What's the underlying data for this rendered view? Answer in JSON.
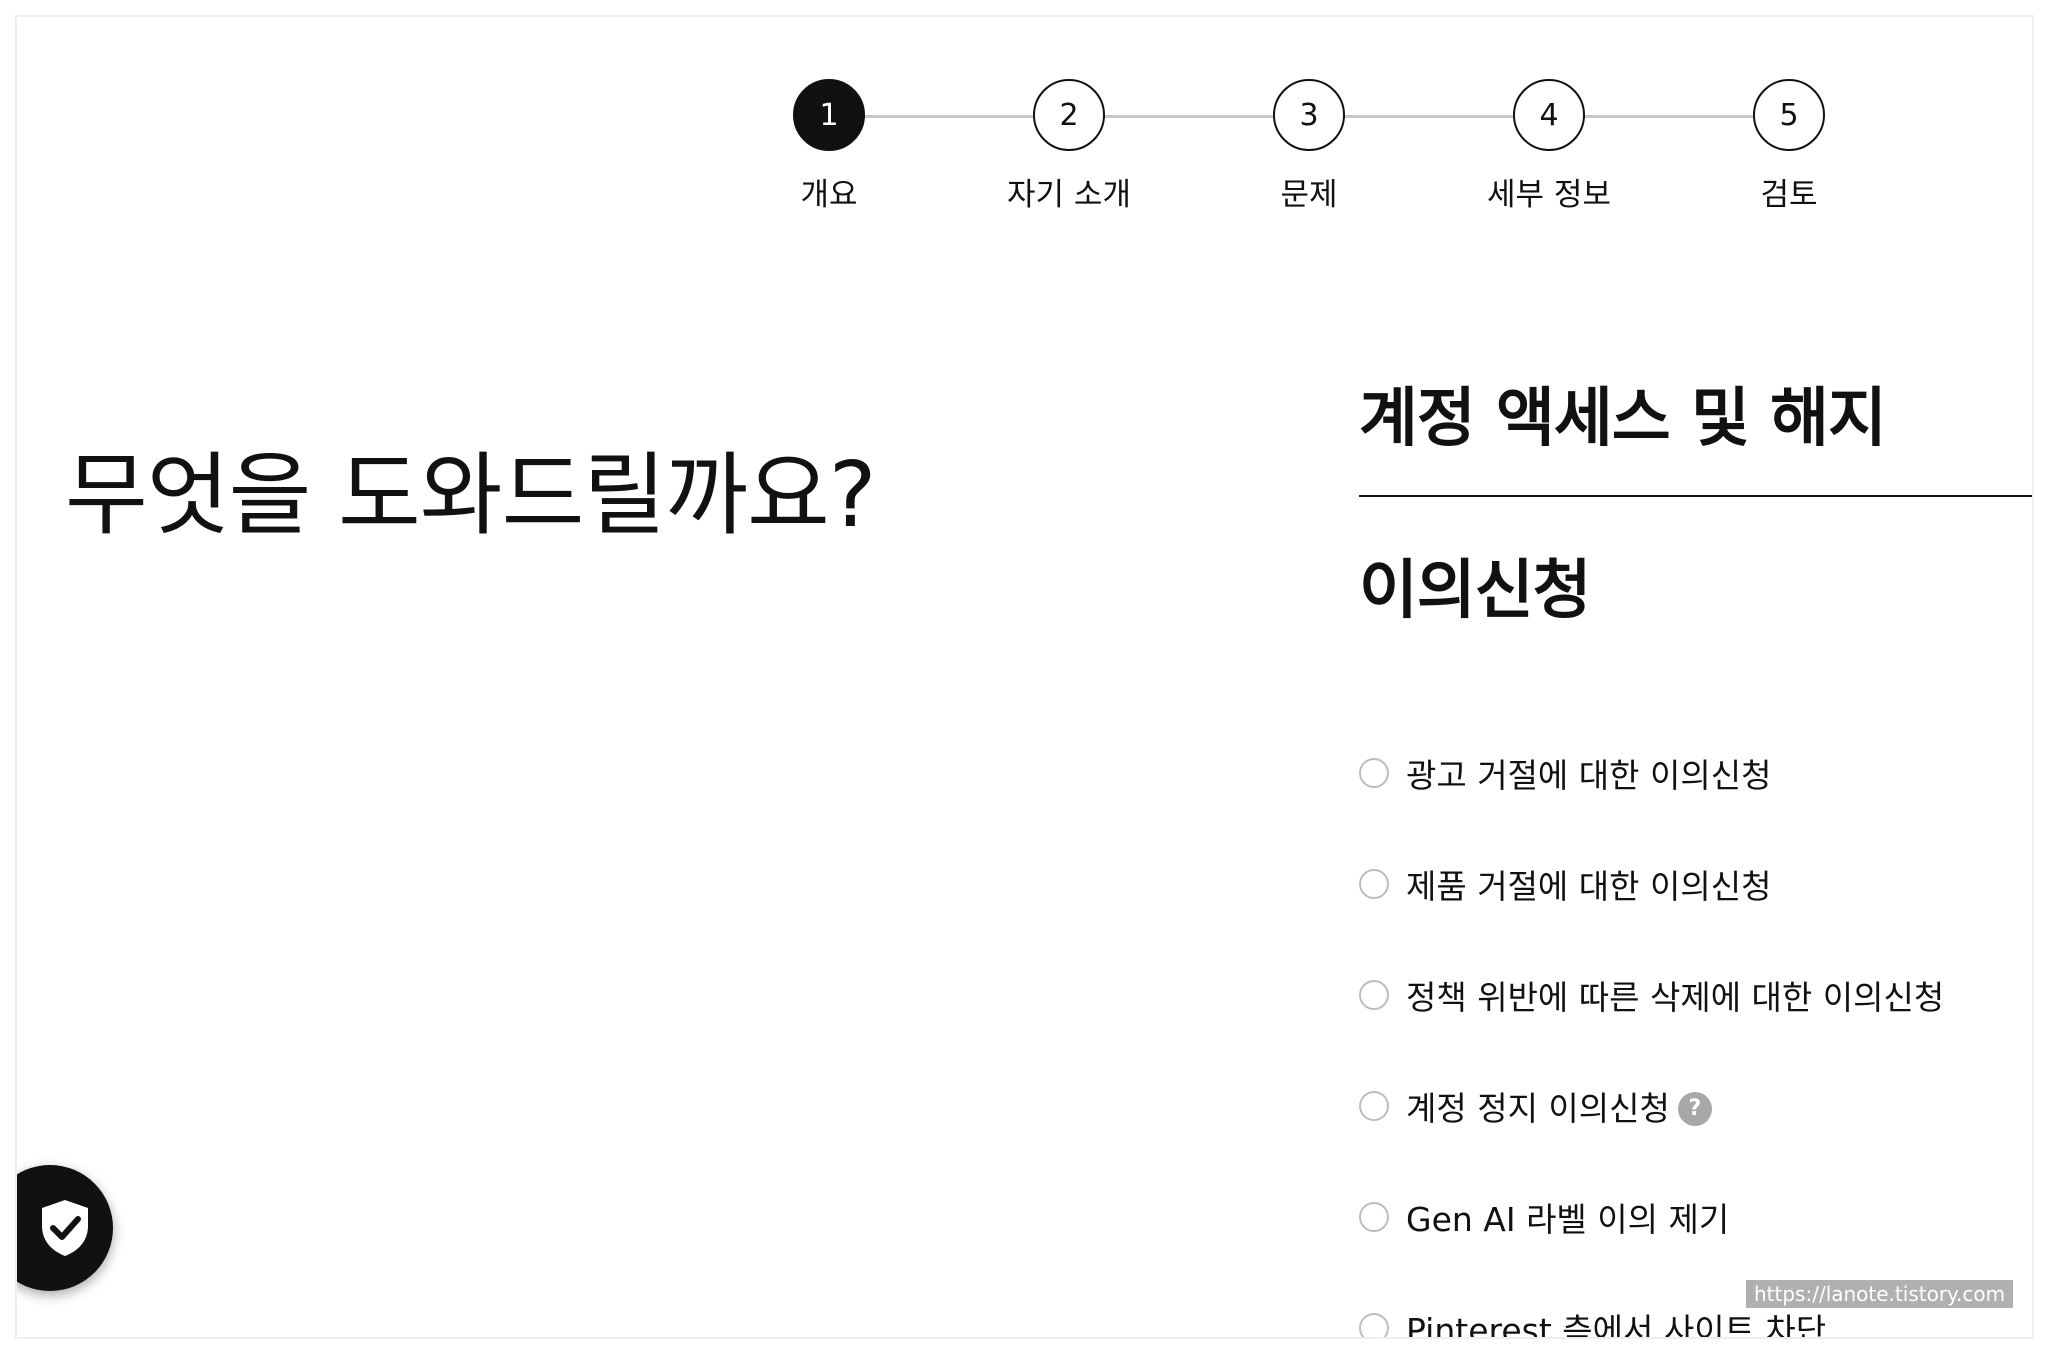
{
  "stepper": {
    "steps": [
      {
        "number": "1",
        "label": "개요",
        "active": true
      },
      {
        "number": "2",
        "label": "자기 소개",
        "active": false
      },
      {
        "number": "3",
        "label": "문제",
        "active": false
      },
      {
        "number": "4",
        "label": "세부 정보",
        "active": false
      },
      {
        "number": "5",
        "label": "검토",
        "active": false
      }
    ]
  },
  "main": {
    "title": "무엇을 도와드릴까요?"
  },
  "panel": {
    "category_heading": "계정 액세스 및 해지",
    "sub_heading": "이의신청",
    "options": [
      {
        "label": "광고 거절에 대한 이의신청"
      },
      {
        "label": "제품 거절에 대한 이의신청"
      },
      {
        "label": "정책 위반에 따른 삭제에 대한 이의신청"
      },
      {
        "label": "계정 정지 이의신청",
        "help": "?"
      },
      {
        "label": "Gen AI 라벨 이의 제기"
      },
      {
        "label": "Pinterest 측에서 사이트 차단"
      }
    ]
  },
  "watermark": "https://lanote.tistory.com",
  "colors": {
    "text": "#111111",
    "step_active": "#111111",
    "step_line": "#c8c8c8",
    "radio_border": "#bdbdbd",
    "help_icon": "#a8a8a8"
  },
  "icons": {
    "shield": "shield-check-icon",
    "help": "help-circle-icon"
  }
}
